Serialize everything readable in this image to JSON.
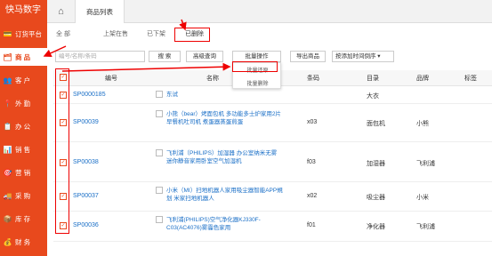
{
  "brand": "快马数字",
  "sidebar": {
    "items": [
      {
        "label": "订货平台",
        "icon": "💳"
      },
      {
        "label": "商 品",
        "icon": "🗂"
      },
      {
        "label": "客 户",
        "icon": "👥"
      },
      {
        "label": "外 勤",
        "icon": "📍"
      },
      {
        "label": "办 公",
        "icon": "📋"
      },
      {
        "label": "销 售",
        "icon": "📊"
      },
      {
        "label": "营 销",
        "icon": "🎯"
      },
      {
        "label": "采 购",
        "icon": "🚚"
      },
      {
        "label": "库 存",
        "icon": "📦"
      },
      {
        "label": "财 务",
        "icon": "💰"
      }
    ]
  },
  "topbar": {
    "home_icon": "⌂",
    "page_tab": "商品列表"
  },
  "status_tabs": [
    "全 部",
    "上架在售",
    "已下架",
    "已删除"
  ],
  "toolbar": {
    "search_placeholder": "编号/名称/条码",
    "search_button": "搜 索",
    "advanced_button": "高级查询",
    "batch_button": "批量操作",
    "export_button": "导出商品",
    "sort_select": "按添加时间倒序 ▾"
  },
  "dropdown": {
    "restore": "批量还原",
    "delete": "批量删除"
  },
  "table": {
    "headers": {
      "code": "编号",
      "name": "名称",
      "barcode": "条码",
      "category": "目录",
      "brand": "品牌",
      "tag": "标签"
    },
    "rows": [
      {
        "code": "SP0000185",
        "name": "东试",
        "barcode": "",
        "category": "大衣",
        "brand": ""
      },
      {
        "code": "SP00039",
        "name": "小熊（bear）烤面包机 多功能多士炉家用2片早餐机吐司机 煮蛋器蒸蛋煎蛋",
        "barcode": "x03",
        "category": "面包机",
        "brand": "小熊"
      },
      {
        "code": "SP00038",
        "name": "飞利浦（PHILIPS）加湿器 办公室纳米无雾 迷你静音家用卧室空气加湿机",
        "barcode": "f03",
        "category": "加湿器",
        "brand": "飞利浦"
      },
      {
        "code": "SP00037",
        "name": "小米（MI）扫地机器人家用吸尘器智能APP規划 米家扫地机器人",
        "barcode": "x02",
        "category": "吸尘器",
        "brand": "小米"
      },
      {
        "code": "SP00036",
        "name": "飞利浦(PHILIPS)空气净化器KJ330F-C03(AC4076)雾霾色家用",
        "barcode": "f01",
        "category": "净化器",
        "brand": "飞利浦"
      }
    ]
  },
  "colors": {
    "accent": "#e8491d",
    "link": "#1a6fc7",
    "annotation": "#ee0000"
  }
}
